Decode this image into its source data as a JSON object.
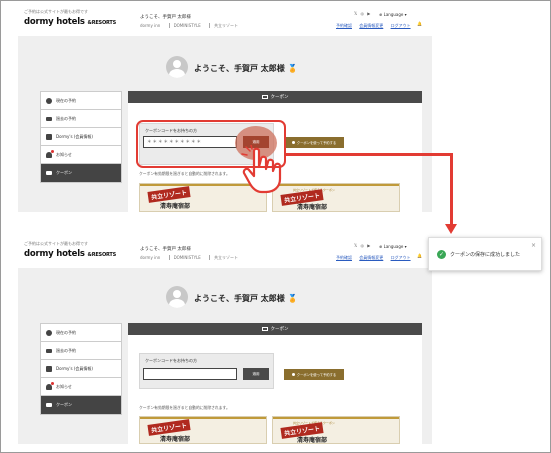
{
  "header": {
    "tagline": "ご予約は公式サイトが最もお得です",
    "logo_main": "dormy hotels",
    "logo_sub": "&RESORTS",
    "user_greeting": "ようこそ、手賀戸 太郎様",
    "nav": [
      "dormy inn",
      "DOMINISTYLE",
      "共立リゾート"
    ],
    "icons": [
      "x-icon",
      "instagram-icon",
      "youtube-icon"
    ],
    "language": "Language",
    "links": [
      "予約確認",
      "会員情報変更",
      "ログアウト"
    ]
  },
  "welcome": {
    "text": "ようこそ、手賀戸 太郎様",
    "medal": "🏅"
  },
  "menu": [
    {
      "label": "現在の予約",
      "icon": "circle-icon"
    },
    {
      "label": "過去の予約",
      "icon": "bed-icon"
    },
    {
      "label": "Dormy's (会員情報)",
      "icon": "person-icon"
    },
    {
      "label": "お知らせ",
      "icon": "bell-icon"
    },
    {
      "label": "クーポン",
      "icon": "ticket-icon",
      "active": true
    }
  ],
  "coupon": {
    "panel_title": "クーポン",
    "label": "クーポンコードをお持ちの方",
    "input_value_masked": "＊＊＊＊＊＊＊＊＊＊",
    "input_value_after": "",
    "apply_label": "適用",
    "use_label": "クーポンを使って予約する",
    "note": "クーポン有効期限を過ぎると自動的に削除されます。"
  },
  "banner": {
    "tag": "共立リゾート",
    "title": "清寿庵宿部",
    "subtitle": "共立リゾートで使えるクーポン"
  },
  "toast": {
    "message": "クーポンの保存に成功しました",
    "close": "×"
  },
  "colors": {
    "accent_red": "#e23b33",
    "success_green": "#3aa756",
    "gold": "#8a6e2e",
    "dark": "#4a4a4a"
  }
}
